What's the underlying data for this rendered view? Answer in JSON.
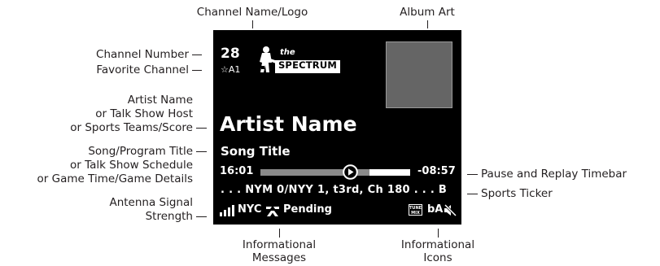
{
  "callouts": {
    "channel_logo": "Channel Name/Logo",
    "album_art": "Album Art",
    "channel_number": "Channel Number",
    "favorite_channel": "Favorite Channel",
    "artist_l1": "Artist Name",
    "artist_l2": "or Talk Show Host",
    "artist_l3": "or Sports Teams/Score",
    "song_l1": "Song/Program Title",
    "song_l2": "or Talk Show Schedule",
    "song_l3": "or Game Time/Game Details",
    "antenna_l1": "Antenna Signal",
    "antenna_l2": "Strength",
    "timebar": "Pause and Replay Timebar",
    "ticker": "Sports Ticker",
    "info_msg_l1": "Informational",
    "info_msg_l2": "Messages",
    "info_icons_l1": "Informational",
    "info_icons_l2": "Icons"
  },
  "screen": {
    "channel_number": "28",
    "favorite": "☆A1",
    "logo_the": "the",
    "logo_name": "SPECTRUM",
    "artist": "Artist Name",
    "song": "Song Title",
    "time_elapsed": "16:01",
    "time_remaining": "-08:57",
    "playback_position": 0.6,
    "buffered_to": 0.73,
    "ticker": ". . . NYM 0/NYY 1, t3rd, Ch 180 . . . B",
    "city": "NYC",
    "status_message": "Pending",
    "tunemix_label": "TUNE MIX",
    "audio_label": "bA"
  },
  "colors": {
    "screen_bg": "#000000",
    "album_art": "#656565",
    "timebar_played": "#8a8a8a",
    "timebar_buffer": "#ffffff"
  }
}
